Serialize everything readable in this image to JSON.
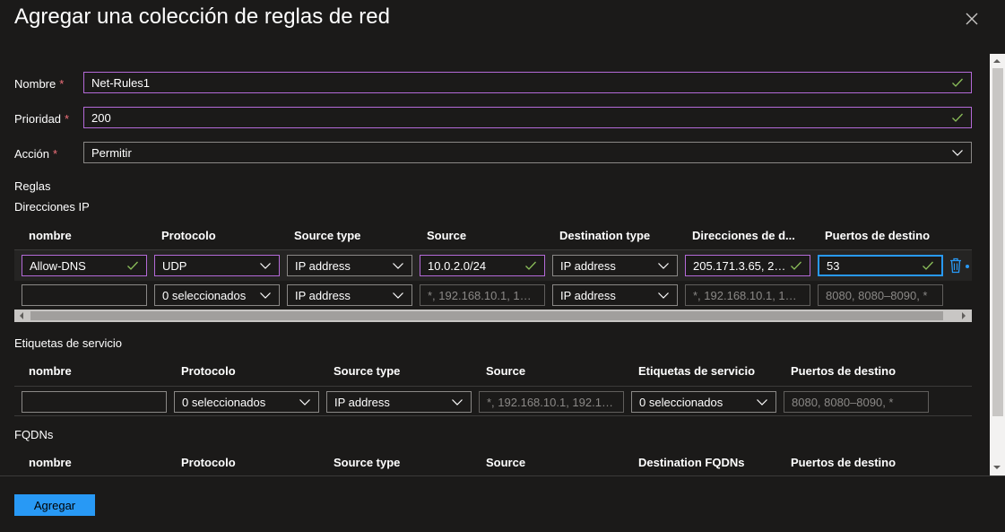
{
  "title": "Agregar una colección de reglas de red",
  "form": {
    "name_label": "Nombre",
    "name_value": "Net-Rules1",
    "priority_label": "Prioridad",
    "priority_value": "200",
    "action_label": "Acción",
    "action_value": "Permitir",
    "required_mark": "*"
  },
  "sections": {
    "rules": "Reglas",
    "ip_addresses": "Direcciones IP",
    "service_tags": "Etiquetas de servicio",
    "fqdns": "FQDNs"
  },
  "ip_table": {
    "headers": [
      "nombre",
      "Protocolo",
      "Source type",
      "Source",
      "Destination type",
      "Direcciones de d...",
      "Puertos de destino"
    ],
    "row1": {
      "name": "Allow-DNS",
      "protocol": "UDP",
      "source_type": "IP address",
      "source": "10.0.2.0/24",
      "destination_type": "IP address",
      "destination_addresses": "205.171.3.65, 205....",
      "destination_ports": "53"
    },
    "row2": {
      "name": "",
      "protocol": "0 seleccionados",
      "source_type": "IP address",
      "source_placeholder": "*, 192.168.10.1, 192....",
      "destination_type": "IP address",
      "destination_placeholder": "*, 192.168.10.1, 192....",
      "ports_placeholder": "8080, 8080–8090, *"
    }
  },
  "service_table": {
    "headers": [
      "nombre",
      "Protocolo",
      "Source type",
      "Source",
      "Etiquetas de servicio",
      "Puertos de destino"
    ],
    "row1": {
      "name": "",
      "protocol": "0 seleccionados",
      "source_type": "IP address",
      "source_placeholder": "*, 192.168.10.1, 192.16...",
      "service_tags": "0 seleccionados",
      "ports_placeholder": "8080, 8080–8090, *"
    }
  },
  "fqdn_table": {
    "headers": [
      "nombre",
      "Protocolo",
      "Source type",
      "Source",
      "Destination FQDNs",
      "Puertos de destino"
    ]
  },
  "footer": {
    "add_button": "Agregar"
  },
  "colors": {
    "accent": "#2899f5",
    "valid_border": "#b46ad8",
    "check": "#8cbf5a",
    "required": "#f1707b"
  }
}
